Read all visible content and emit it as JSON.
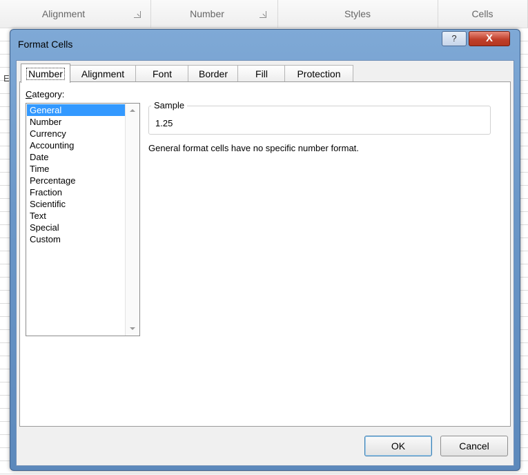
{
  "ribbon": {
    "groups": [
      "Alignment",
      "Number",
      "Styles",
      "Cells"
    ]
  },
  "grid": {
    "column_letter": "E"
  },
  "dialog": {
    "title": "Format Cells",
    "help_glyph": "?",
    "close_glyph": "X",
    "tabs": [
      "Number",
      "Alignment",
      "Font",
      "Border",
      "Fill",
      "Protection"
    ],
    "active_tab": "Number",
    "category_label_underlined": "C",
    "category_label_rest": "ategory:",
    "categories": [
      "General",
      "Number",
      "Currency",
      "Accounting",
      "Date",
      "Time",
      "Percentage",
      "Fraction",
      "Scientific",
      "Text",
      "Special",
      "Custom"
    ],
    "selected_category": "General",
    "sample_title": "Sample",
    "sample_value": "1.25",
    "description": "General format cells have no specific number format.",
    "ok_label": "OK",
    "cancel_label": "Cancel"
  },
  "colors": {
    "selection": "#3399ff",
    "dialog_frame": "#6b97c8",
    "close_button": "#c0402b"
  }
}
